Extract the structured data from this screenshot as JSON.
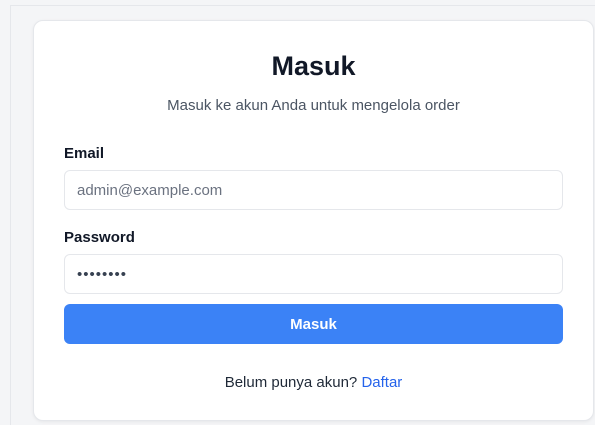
{
  "login": {
    "title": "Masuk",
    "subtitle": "Masuk ke akun Anda untuk mengelola order",
    "email_label": "Email",
    "email_placeholder": "admin@example.com",
    "password_label": "Password",
    "password_value": "••••••••",
    "submit_label": "Masuk",
    "register_prompt": "Belum punya akun?",
    "register_link": "Daftar"
  },
  "colors": {
    "accent": "#3b82f6",
    "link": "#2563eb",
    "background": "#f4f5f7",
    "card": "#ffffff"
  }
}
